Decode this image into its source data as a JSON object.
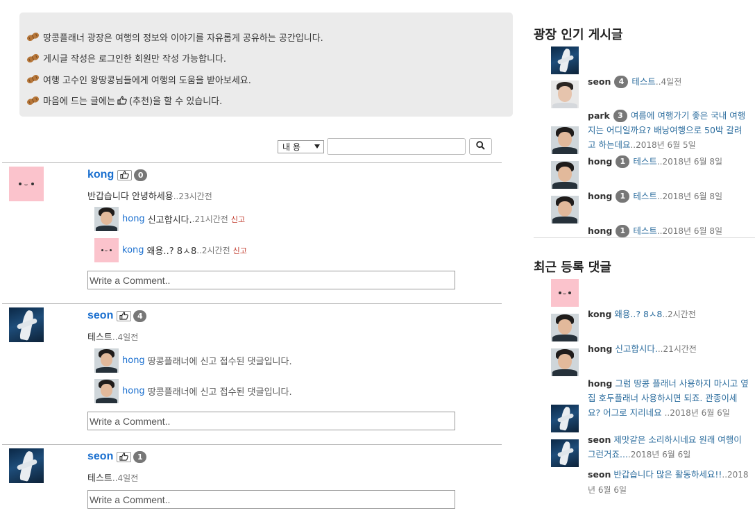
{
  "notice": {
    "lines": [
      "땅콩플래너 광장은 여행의 정보와 이야기를 자유롭게 공유하는 공간입니다.",
      "게시글 작성은 로그인한 회원만 작성 가능합니다.",
      "여행 고수인 왕땅콩님들에게 여행의 도움을 받아보세요.",
      "마음에 드는 글에는 (추천)을 할 수 있습니다."
    ],
    "line4_prefix": "마음에 드는 글에는",
    "line4_suffix": "(추천)을 할 수 있습니다."
  },
  "search": {
    "select_value": "내 용",
    "input_value": ""
  },
  "posts": [
    {
      "author": "kong",
      "likes": "0",
      "body": "반갑습니다 안녕하세용",
      "time": "..23시간전",
      "comments": [
        {
          "author": "hong",
          "text": "신고합시다.",
          "time": ".21시간전",
          "report": "신고"
        },
        {
          "author": "kong",
          "text": "왜용..? 8ㅅ8",
          "time": "..2시간전",
          "report": "신고"
        }
      ],
      "comment_placeholder": "Write a Comment.."
    },
    {
      "author": "seon",
      "likes": "4",
      "body": "테스트",
      "time": "..4일전",
      "comments": [
        {
          "author": "hong",
          "text": "땅콩플래너에 신고 접수된 댓글입니다."
        },
        {
          "author": "hong",
          "text": "땅콩플래너에 신고 접수된 댓글입니다."
        }
      ],
      "comment_placeholder": "Write a Comment.."
    },
    {
      "author": "seon",
      "likes": "1",
      "body": "테스트",
      "time": "..4일전",
      "comments": [],
      "comment_placeholder": "Write a Comment.."
    }
  ],
  "sidebar": {
    "popular_title": "광장 인기 게시글",
    "popular": [
      {
        "author": "seon",
        "count": "4",
        "title": "테스트",
        "time": "..4일전"
      },
      {
        "author": "park",
        "count": "3",
        "title": "여름에 여행가기 좋은 국내 여행지는 어디일까요? 배낭여행으로 50박 갈려고 하는데요",
        "time": "..2018년 6월 5일"
      },
      {
        "author": "hong",
        "count": "1",
        "title": "테스트",
        "time": "..2018년 6월 8일"
      },
      {
        "author": "hong",
        "count": "1",
        "title": "테스트",
        "time": "..2018년 6월 8일"
      },
      {
        "author": "hong",
        "count": "1",
        "title": "테스트",
        "time": "..2018년 6월 8일"
      }
    ],
    "recent_title": "최근 등록 댓글",
    "recent": [
      {
        "author": "kong",
        "text": "왜용..? 8ㅅ8",
        "time": "..2시간전"
      },
      {
        "author": "hong",
        "text": "신고합시다.",
        "time": "..21시간전"
      },
      {
        "author": "hong",
        "text": "그럼 땅콩 플래너 사용하지 마시고 옆집 호두플래너 사용하시면 되죠. 관종이세요? 어그로 지리네요 ",
        "time": "..2018년 6월 6일"
      },
      {
        "author": "seon",
        "text": "제맛같은 소리하시네요 원래 여행이 그런거죠...",
        "time": ".2018년 6월 6일"
      },
      {
        "author": "seon",
        "text": "반갑습니다 많은 활동하세요!!",
        "time": "..2018년 6월 6일"
      }
    ]
  },
  "colors": {
    "link_blue": "#1a6fcf",
    "report_red": "#c0392b",
    "notice_bg": "#ebebeb",
    "badge_gray": "#777777"
  }
}
